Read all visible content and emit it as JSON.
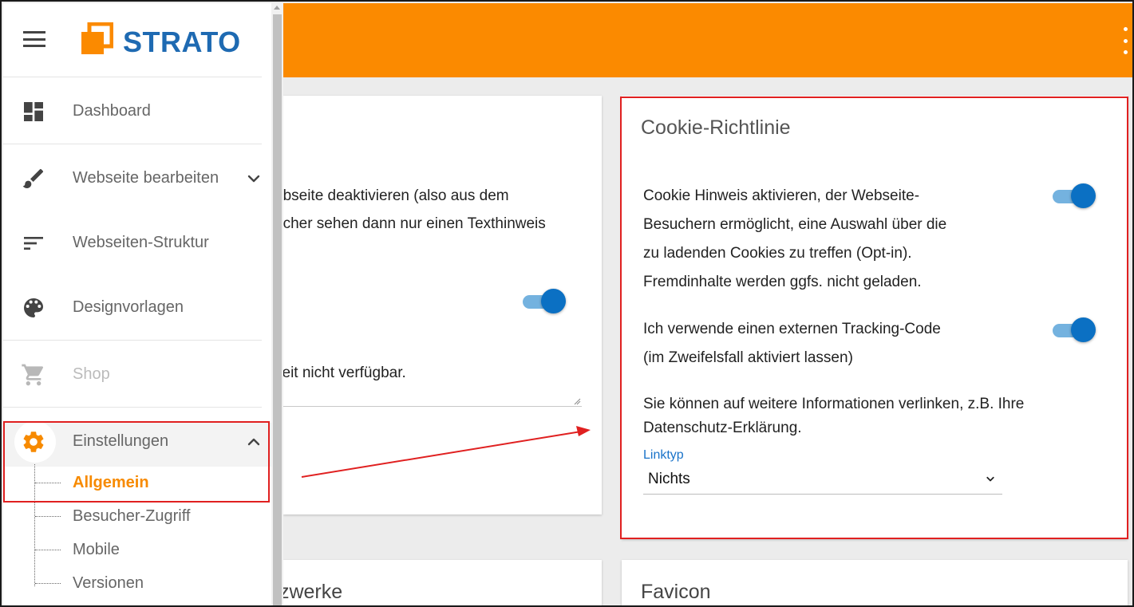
{
  "brand": {
    "name": "STRATO",
    "logo_color": "#1e6ab2",
    "mark_color": "#fb8a00"
  },
  "colors": {
    "header": "#fb8a00",
    "accent_active": "#f78a00",
    "toggle": "#0b70c3",
    "link": "#1a73c9",
    "highlight_box": "#e02020"
  },
  "header": {
    "menu_icon": "more-vert-icon"
  },
  "sidebar": {
    "menu_icon": "hamburger-icon",
    "items": [
      {
        "label": "Dashboard",
        "icon": "dashboard-icon"
      },
      {
        "label": "Webseite bearbeiten",
        "icon": "brush-icon",
        "expand": "chevron-down-icon"
      },
      {
        "label": "Webseiten-Struktur",
        "icon": "sort-icon"
      },
      {
        "label": "Designvorlagen",
        "icon": "palette-icon"
      },
      {
        "label": "Shop",
        "icon": "cart-icon",
        "disabled": true
      },
      {
        "label": "Einstellungen",
        "icon": "gear-icon",
        "expand": "chevron-up-icon",
        "expanded": true
      }
    ],
    "subitems": [
      {
        "label": "Allgemein",
        "active": true
      },
      {
        "label": "Besucher-Zugriff"
      },
      {
        "label": "Mobile"
      },
      {
        "label": "Versionen"
      }
    ]
  },
  "left_card": {
    "line1": "ebseite deaktivieren (also aus dem",
    "line2": "ucher sehen dann nur einen Texthinweis",
    "toggle_on": true,
    "textarea_value": "zeit nicht verfügbar."
  },
  "cookie_card": {
    "title": "Cookie-Richtlinie",
    "option1_lines": [
      "Cookie Hinweis aktivieren, der Webseite-",
      "Besuchern ermöglicht, eine Auswahl über die",
      "zu ladenden Cookies zu treffen (Opt-in).",
      "Fremdinhalte werden ggfs. nicht geladen."
    ],
    "option1_on": true,
    "option2_lines": [
      "Ich verwende einen externen Tracking-Code",
      "(im Zweifelsfall aktiviert lassen)"
    ],
    "option2_on": true,
    "info_lines": [
      "Sie können auf weitere Informationen verlinken, z.B. Ihre",
      "Datenschutz-Erklärung."
    ],
    "linktyp_label": "Linktyp",
    "linktyp_value": "Nichts"
  },
  "bottom_left_card": {
    "title": "tzwerke"
  },
  "bottom_right_card": {
    "title": "Favicon"
  }
}
